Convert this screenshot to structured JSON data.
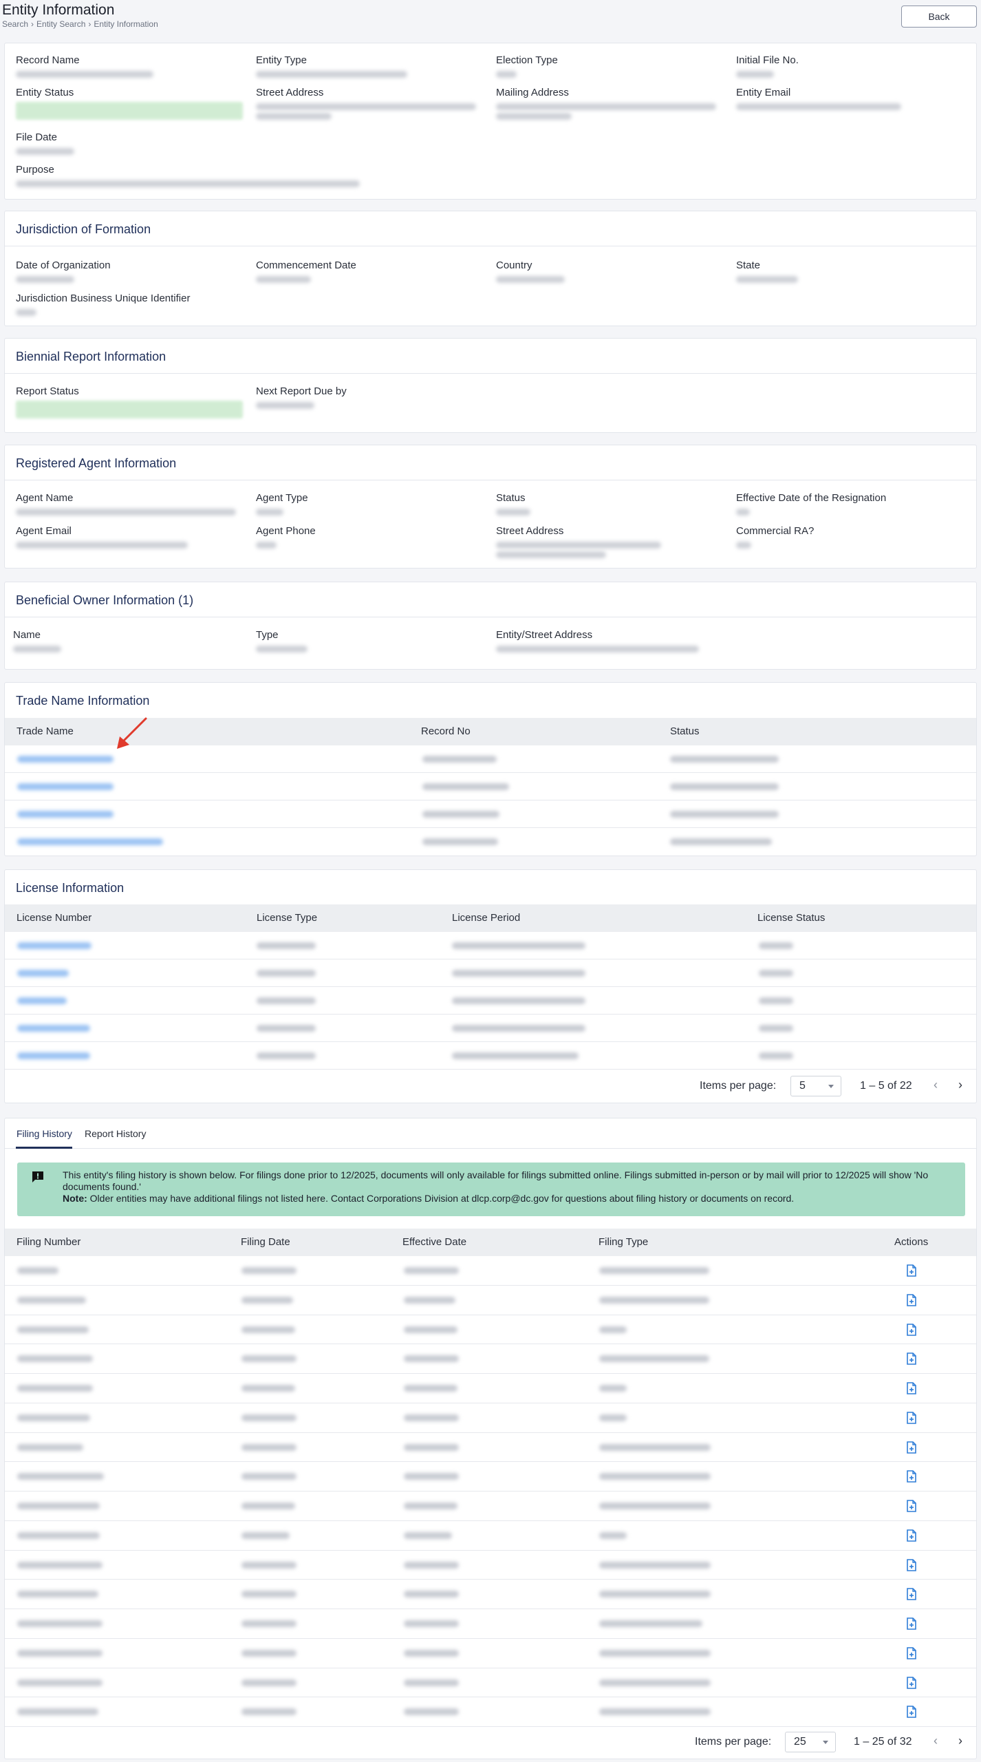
{
  "header": {
    "title": "Entity Information",
    "breadcrumb": [
      "Search",
      "Entity Search",
      "Entity Information"
    ],
    "back_label": "Back"
  },
  "entity": {
    "fields": [
      "Record Name",
      "Entity Type",
      "Election Type",
      "Initial File No.",
      "Entity Status",
      "Street Address",
      "Mailing Address",
      "Entity Email",
      "File Date",
      "Purpose"
    ]
  },
  "jurisdiction": {
    "title": "Jurisdiction of Formation",
    "fields": [
      "Date of Organization",
      "Commencement Date",
      "Country",
      "State",
      "Jurisdiction Business Unique Identifier"
    ]
  },
  "biennial": {
    "title": "Biennial Report Information",
    "fields": [
      "Report Status",
      "Next Report Due by"
    ]
  },
  "agent": {
    "title": "Registered Agent Information",
    "fields": [
      "Agent Name",
      "Agent Type",
      "Status",
      "Effective Date of the Resignation",
      "Agent Email",
      "Agent Phone",
      "Street Address",
      "Commercial RA?"
    ]
  },
  "beneficial": {
    "title": "Beneficial Owner Information (1)",
    "fields": [
      "Name",
      "Type",
      "Entity/Street Address"
    ]
  },
  "trade": {
    "title": "Trade Name Information",
    "columns": [
      "Trade Name",
      "Record No",
      "Status"
    ]
  },
  "license": {
    "title": "License Information",
    "columns": [
      "License Number",
      "License Type",
      "License Period",
      "License Status"
    ],
    "pager": {
      "items_label": "Items per page:",
      "per_page": "5",
      "range": "1 – 5 of 22"
    }
  },
  "filing": {
    "tabs": [
      "Filing History",
      "Report History"
    ],
    "notice_text": "This entity's filing history is shown below. For filings done prior to 12/2025, documents will only available for filings submitted online. Filings submitted in-person or by mail will prior to 12/2025 will show 'No documents found.'",
    "notice_note_label": "Note:",
    "notice_note": "Older entities may have additional filings not listed here. Contact Corporations Division at dlcp.corp@dc.gov for questions about filing history or documents on record.",
    "columns": [
      "Filing Number",
      "Filing Date",
      "Effective Date",
      "Filing Type",
      "Actions"
    ],
    "pager": {
      "items_label": "Items per page:",
      "per_page": "25",
      "range": "1 – 25 of 32"
    }
  },
  "icons": {
    "prev": "‹",
    "next": "›"
  },
  "colors": {
    "primary": "#20305a",
    "link": "#2e7dd7",
    "status_green": "#cdebcf",
    "notice": "#a8dcc6",
    "arrow": "#e03a2c"
  }
}
